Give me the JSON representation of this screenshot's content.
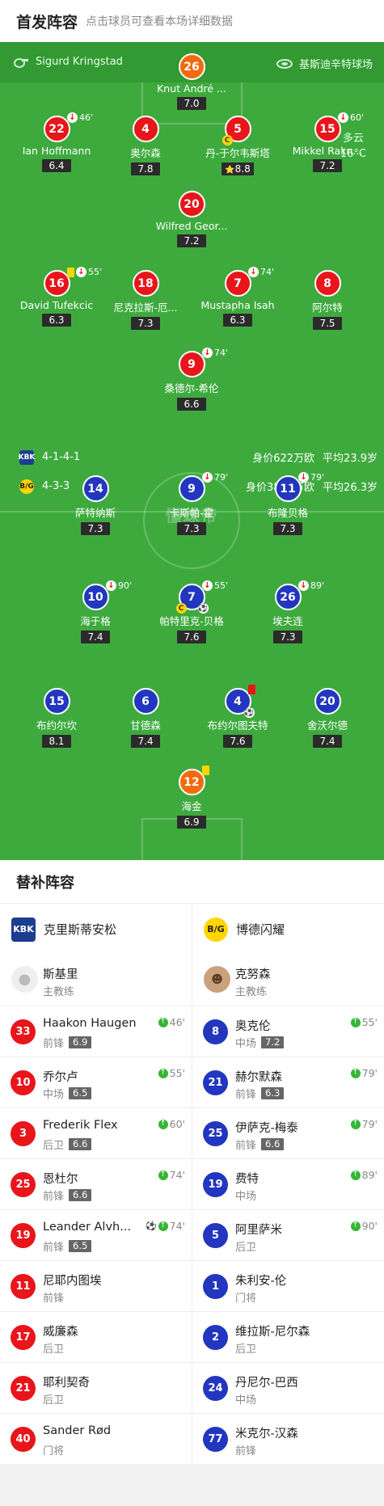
{
  "header": {
    "title": "首发阵容",
    "subtitle": "点击球员可查看本场详细数据"
  },
  "match": {
    "referee": "Sigurd Kringstad",
    "venue": "基斯迪辛特球场",
    "weather": "多云",
    "temperature": "16°C",
    "watermark": "懂球帝"
  },
  "home_info": {
    "formation": "4-1-4-1",
    "market_value": "身价622万欧",
    "avg_age": "平均23.9岁",
    "logo_text": "KBK"
  },
  "away_info": {
    "formation": "4-3-3",
    "market_value": "身价3855万欧",
    "avg_age": "平均26.3岁",
    "logo_text": "B/G"
  },
  "home_players": [
    {
      "num": "26",
      "name": "Knut André ...",
      "rating": "7.0",
      "gk": true,
      "events": []
    },
    {
      "num": "22",
      "name": "Ian Hoffmann",
      "rating": "6.4",
      "events": [
        {
          "t": "sub",
          "min": "46'"
        }
      ]
    },
    {
      "num": "4",
      "name": "奥尔森",
      "rating": "7.8",
      "events": []
    },
    {
      "num": "5",
      "name": "丹-于尔韦斯塔",
      "rating": "8.8",
      "star": true,
      "captain": true,
      "events": []
    },
    {
      "num": "15",
      "name": "Mikkel Rakn...",
      "rating": "7.2",
      "events": [
        {
          "t": "sub",
          "min": "60'"
        }
      ]
    },
    {
      "num": "20",
      "name": "Wilfred Geor...",
      "rating": "7.2",
      "events": []
    },
    {
      "num": "16",
      "name": "David Tufekcic",
      "rating": "6.3",
      "events": [
        {
          "t": "yc"
        },
        {
          "t": "sub",
          "min": "55'"
        }
      ]
    },
    {
      "num": "18",
      "name": "尼克拉斯-厄...",
      "rating": "7.3",
      "events": []
    },
    {
      "num": "7",
      "name": "Mustapha Isah",
      "rating": "6.3",
      "events": [
        {
          "t": "sub",
          "min": "74'"
        }
      ]
    },
    {
      "num": "8",
      "name": "阿尔特",
      "rating": "7.5",
      "events": []
    },
    {
      "num": "9",
      "name": "桑德尔-希伦",
      "rating": "6.6",
      "events": [
        {
          "t": "sub",
          "min": "74'"
        }
      ]
    }
  ],
  "away_players": [
    {
      "num": "14",
      "name": "萨特纳斯",
      "rating": "7.3",
      "events": []
    },
    {
      "num": "9",
      "name": "卡斯帕-霍",
      "rating": "7.3",
      "events": [
        {
          "t": "sub",
          "min": "79'"
        }
      ]
    },
    {
      "num": "11",
      "name": "布隆贝格",
      "rating": "7.3",
      "events": [
        {
          "t": "sub",
          "min": "79'"
        }
      ]
    },
    {
      "num": "10",
      "name": "海于格",
      "rating": "7.4",
      "events": [
        {
          "t": "sub",
          "min": "90'"
        }
      ]
    },
    {
      "num": "7",
      "name": "帕特里克-贝格",
      "rating": "7.6",
      "captain": true,
      "ball": true,
      "events": [
        {
          "t": "sub",
          "min": "55'"
        }
      ]
    },
    {
      "num": "26",
      "name": "埃夫连",
      "rating": "7.3",
      "events": [
        {
          "t": "sub",
          "min": "89'"
        }
      ]
    },
    {
      "num": "15",
      "name": "布约尔坎",
      "rating": "8.1",
      "events": []
    },
    {
      "num": "6",
      "name": "甘德森",
      "rating": "7.4",
      "events": []
    },
    {
      "num": "4",
      "name": "布约尔图夫特",
      "rating": "7.6",
      "ball": true,
      "events": [
        {
          "t": "rc"
        }
      ]
    },
    {
      "num": "20",
      "name": "舍沃尔德",
      "rating": "7.4",
      "events": []
    },
    {
      "num": "12",
      "name": "海金",
      "rating": "6.9",
      "gk": true,
      "events": [
        {
          "t": "yc"
        }
      ]
    }
  ],
  "subs": {
    "title": "替补阵容",
    "home": {
      "team": "克里斯蒂安松",
      "logo_text": "KBK",
      "coach_name": "斯基里",
      "coach_role": "主教练",
      "players": [
        {
          "num": "33",
          "name": "Haakon Haugen",
          "pos": "前锋",
          "rating": "6.9",
          "min": "46'"
        },
        {
          "num": "10",
          "name": "乔尔卢",
          "pos": "中场",
          "rating": "6.5",
          "min": "55'"
        },
        {
          "num": "3",
          "name": "Frederik Flex",
          "pos": "后卫",
          "rating": "6.6",
          "min": "60'"
        },
        {
          "num": "25",
          "name": "恩杜尔",
          "pos": "前锋",
          "rating": "6.6",
          "min": "74'"
        },
        {
          "num": "19",
          "name": "Leander Alvh...",
          "pos": "前锋",
          "rating": "6.5",
          "min": "74'",
          "goal": true
        },
        {
          "num": "11",
          "name": "尼耶内图埃",
          "pos": "前锋"
        },
        {
          "num": "17",
          "name": "威廉森",
          "pos": "后卫"
        },
        {
          "num": "21",
          "name": "耶利契奇",
          "pos": "后卫"
        },
        {
          "num": "40",
          "name": "Sander Rød",
          "pos": "门将"
        }
      ]
    },
    "away": {
      "team": "博德闪耀",
      "logo_text": "B/G",
      "coach_name": "克努森",
      "coach_role": "主教练",
      "players": [
        {
          "num": "8",
          "name": "奥克伦",
          "pos": "中场",
          "rating": "7.2",
          "min": "55'"
        },
        {
          "num": "21",
          "name": "赫尔默森",
          "pos": "前锋",
          "rating": "6.3",
          "min": "79'"
        },
        {
          "num": "25",
          "name": "伊萨克-梅泰",
          "pos": "前锋",
          "rating": "6.6",
          "min": "79'"
        },
        {
          "num": "19",
          "name": "费特",
          "pos": "中场",
          "min": "89'"
        },
        {
          "num": "5",
          "name": "阿里萨米",
          "pos": "后卫",
          "min": "90'"
        },
        {
          "num": "1",
          "name": "朱利安-伦",
          "pos": "门将"
        },
        {
          "num": "2",
          "name": "维拉斯-尼尔森",
          "pos": "后卫"
        },
        {
          "num": "24",
          "name": "丹尼尔-巴西",
          "pos": "中场"
        },
        {
          "num": "77",
          "name": "米克尔-汉森",
          "pos": "前锋"
        }
      ]
    }
  },
  "colors": {
    "pitch": "#3eaa3e",
    "home": "#e8151b",
    "away": "#2236bf",
    "gk": "#f26a0d"
  }
}
